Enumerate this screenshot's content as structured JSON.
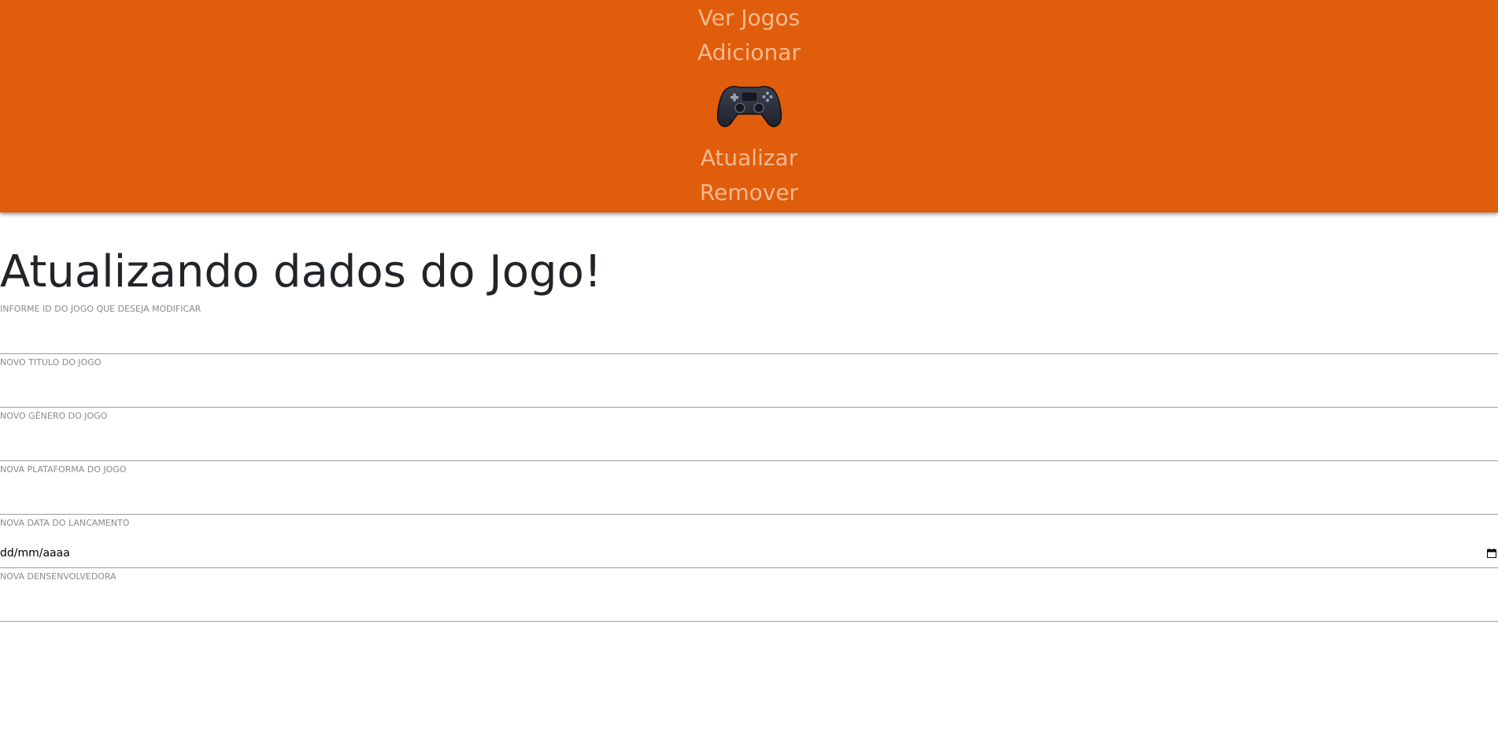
{
  "nav": {
    "links": [
      "Ver Jogos",
      "Adicionar",
      "Atualizar",
      "Remover"
    ],
    "logo_icon": "gamepad-icon"
  },
  "main": {
    "title": "Atualizando dados do Jogo!",
    "fields": [
      {
        "label": "INFORME ID DO JOGO QUE DESEJA MODIFICAR",
        "value": ""
      },
      {
        "label": "NOVO TITULO DO JOGO",
        "value": ""
      },
      {
        "label": "NOVO GÊNERO DO JOGO",
        "value": ""
      },
      {
        "label": "NOVA PLATAFORMA DO JOGO",
        "value": ""
      },
      {
        "label": "NOVA DATA DO LANCAMENTO",
        "value": "dd/mm/aaaa",
        "type": "date"
      },
      {
        "label": "NOVA DENSENVOLVEDORA",
        "value": ""
      }
    ]
  },
  "colors": {
    "nav_bg": "#e05d0c",
    "nav_link": "#f7b98f",
    "title": "#212529"
  }
}
